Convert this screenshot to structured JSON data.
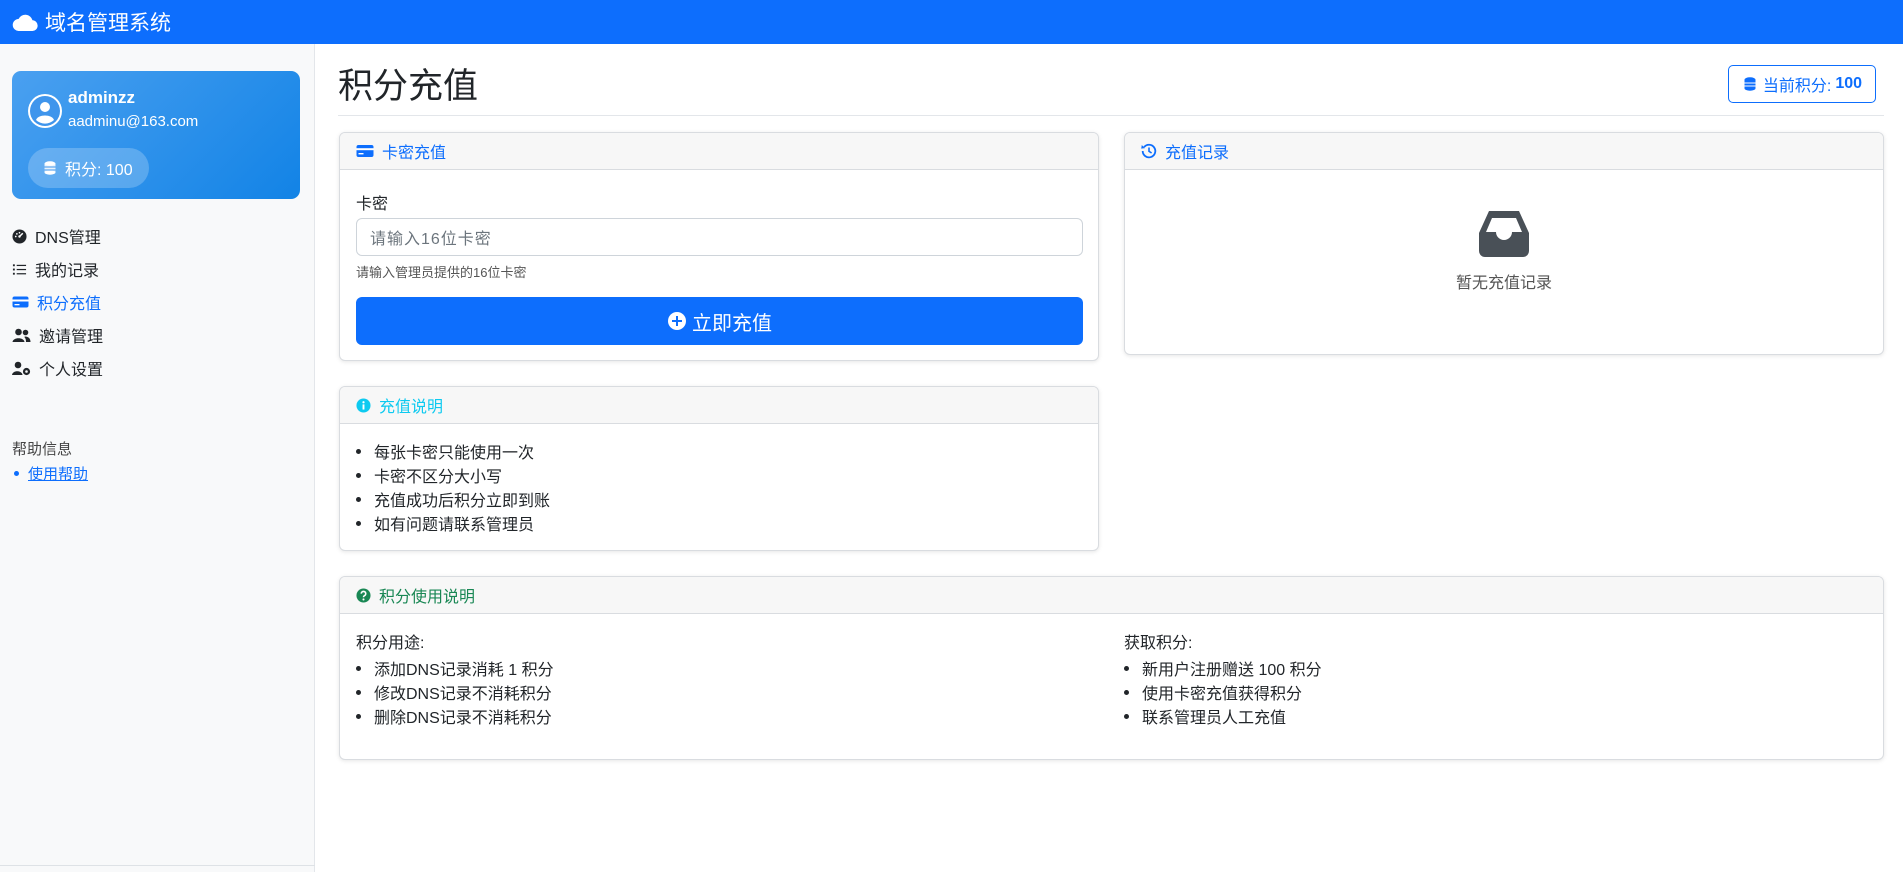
{
  "navbar": {
    "brand": "域名管理系统",
    "brand_icon": "cloud-icon",
    "color": "#0d6efd"
  },
  "sidebar": {
    "user": {
      "name": "adminzz",
      "email": "aadminu@163.com",
      "points_label": "积分: 100"
    },
    "nav": [
      {
        "label": "DNS管理",
        "icon": "speedometer-icon"
      },
      {
        "label": "我的记录",
        "icon": "list-icon"
      },
      {
        "label": "积分充值",
        "icon": "credit-card-icon",
        "active": true
      },
      {
        "label": "邀请管理",
        "icon": "people-icon"
      },
      {
        "label": "个人设置",
        "icon": "person-gear-icon"
      }
    ],
    "help": {
      "title": "帮助信息",
      "link": "使用帮助"
    }
  },
  "main": {
    "title": "积分充值",
    "current_points": {
      "label": "当前积分:",
      "value": "100"
    },
    "recharge_card": {
      "header": "卡密充值",
      "field_label": "卡密",
      "placeholder": "请输入16位卡密",
      "hint": "请输入管理员提供的16位卡密",
      "button": "立即充值"
    },
    "records_card": {
      "header": "充值记录",
      "empty_text": "暂无充值记录"
    },
    "instructions_card": {
      "header": "充值说明",
      "items": [
        "每张卡密只能使用一次",
        "卡密不区分大小写",
        "充值成功后积分立即到账",
        "如有问题请联系管理员"
      ]
    },
    "usage_card": {
      "header": "积分使用说明",
      "left": {
        "title": "积分用途:",
        "items": [
          "添加DNS记录消耗 1 积分",
          "修改DNS记录不消耗积分",
          "删除DNS记录不消耗积分"
        ]
      },
      "right": {
        "title": "获取积分:",
        "items": [
          "新用户注册赠送 100 积分",
          "使用卡密充值获得积分",
          "联系管理员人工充值"
        ]
      }
    }
  },
  "colors": {
    "primary": "#0d6efd",
    "info": "#0dcaf0",
    "success": "#198754",
    "secondary": "#495057"
  }
}
